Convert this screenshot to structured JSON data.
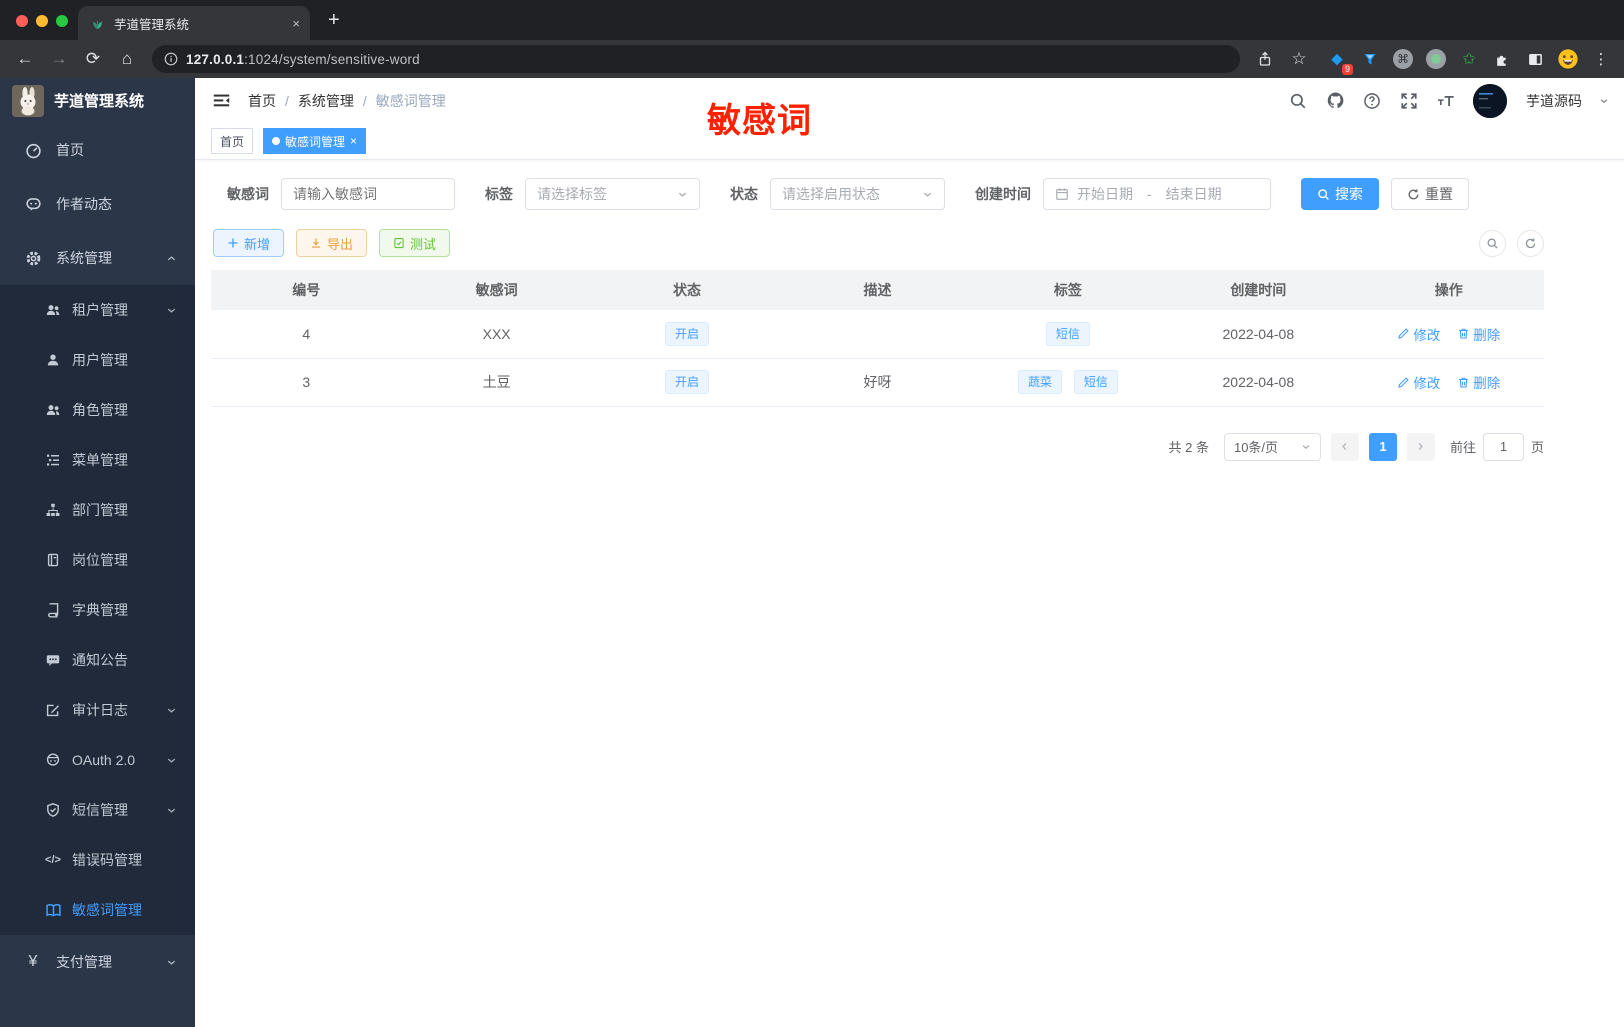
{
  "browser": {
    "tab_title": "芋道管理系统",
    "close_tab": "×",
    "new_tab": "+",
    "back": "←",
    "forward": "→",
    "reload": "⟳",
    "home": "⌂",
    "url_host": "127.0.0.1",
    "url_rest": ":1024/system/sensitive-word",
    "extension_badge": "9",
    "star": "☆",
    "menu_dots": "⋮"
  },
  "sidebar": {
    "title": "芋道管理系统",
    "items": [
      {
        "label": "首页",
        "icon": "dashboard-icon"
      },
      {
        "label": "作者动态",
        "icon": "chat-icon"
      },
      {
        "label": "系统管理",
        "icon": "gear-icon"
      },
      {
        "label": "租户管理",
        "icon": "tenant-icon"
      },
      {
        "label": "用户管理",
        "icon": "user-icon"
      },
      {
        "label": "角色管理",
        "icon": "role-icon"
      },
      {
        "label": "菜单管理",
        "icon": "menu-tree-icon"
      },
      {
        "label": "部门管理",
        "icon": "dept-icon"
      },
      {
        "label": "岗位管理",
        "icon": "post-icon"
      },
      {
        "label": "字典管理",
        "icon": "dict-icon"
      },
      {
        "label": "通知公告",
        "icon": "notice-icon"
      },
      {
        "label": "审计日志",
        "icon": "audit-icon"
      },
      {
        "label": "OAuth 2.0",
        "icon": "oauth-icon"
      },
      {
        "label": "短信管理",
        "icon": "sms-shield-icon"
      },
      {
        "label": "错误码管理",
        "icon": "code-icon"
      },
      {
        "label": "敏感词管理",
        "icon": "book-open-icon"
      },
      {
        "label": "支付管理",
        "icon": "pay-icon"
      }
    ],
    "code_glyph": "</>",
    "pay_glyph": "¥"
  },
  "navbar": {
    "breadcrumb": [
      "首页",
      "系统管理",
      "敏感词管理"
    ],
    "separator": "/",
    "username": "芋道源码"
  },
  "annotation": {
    "text": "敏感词",
    "color": "#ff2000"
  },
  "tags_view": {
    "home_tab": "首页",
    "active_tab": "敏感词管理",
    "close": "×"
  },
  "filters": {
    "keyword_label": "敏感词",
    "keyword_placeholder": "请输入敏感词",
    "tag_label": "标签",
    "tag_placeholder": "请选择标签",
    "status_label": "状态",
    "status_placeholder": "请选择启用状态",
    "date_label": "创建时间",
    "date_start_placeholder": "开始日期",
    "date_separator": "-",
    "date_end_placeholder": "结束日期",
    "search_label": "搜索",
    "reset_label": "重置"
  },
  "toolbar": {
    "add": "新增",
    "export": "导出",
    "test": "测试"
  },
  "table": {
    "columns": [
      "编号",
      "敏感词",
      "状态",
      "描述",
      "标签",
      "创建时间",
      "操作"
    ],
    "actions": {
      "edit": "修改",
      "delete": "删除"
    },
    "rows": [
      {
        "id": "4",
        "word": "XXX",
        "status": "开启",
        "description": "",
        "tags": [
          "短信"
        ],
        "create_time": "2022-04-08"
      },
      {
        "id": "3",
        "word": "土豆",
        "status": "开启",
        "description": "好呀",
        "tags": [
          "蔬菜",
          "短信"
        ],
        "create_time": "2022-04-08"
      }
    ]
  },
  "pagination": {
    "total_text": "共 2 条",
    "page_size_text": "10条/页",
    "prev": "‹",
    "next": "›",
    "current_page": "1",
    "goto_label": "前往",
    "goto_value": "1",
    "unit_label": "页"
  },
  "colors": {
    "accent": "#409eff",
    "warning": "#e6a23c",
    "success": "#67c23a",
    "annotation_red": "#ff2000",
    "sidebar_bg": "#2b3649",
    "submenu_bg": "#212a3a",
    "tag_bg": "#ecf5ff",
    "table_header_bg": "#f2f3f5"
  }
}
